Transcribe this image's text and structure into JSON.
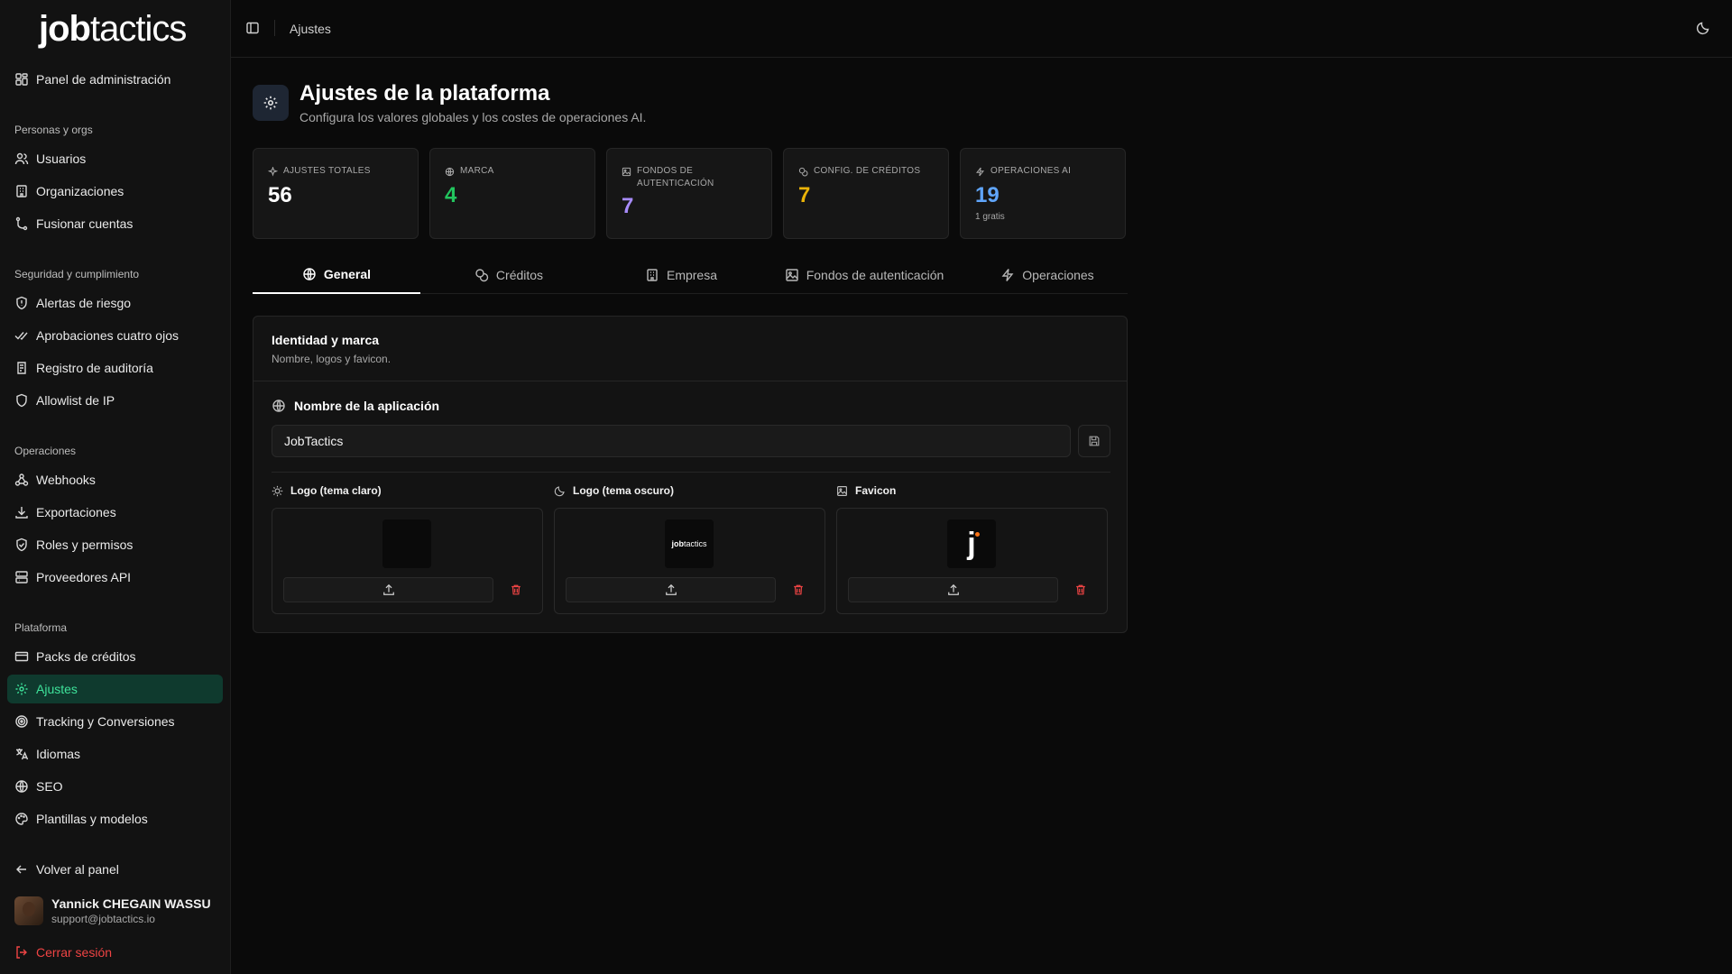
{
  "app": {
    "logo_bold": "job",
    "logo_light": "tactics"
  },
  "breadcrumb": {
    "current": "Ajustes"
  },
  "sidebar": {
    "top_item": "Panel de administración",
    "sections": [
      {
        "label": "Personas y orgs",
        "items": [
          "Usuarios",
          "Organizaciones",
          "Fusionar cuentas"
        ]
      },
      {
        "label": "Seguridad y cumplimiento",
        "items": [
          "Alertas de riesgo",
          "Aprobaciones cuatro ojos",
          "Registro de auditoría",
          "Allowlist de IP"
        ]
      },
      {
        "label": "Operaciones",
        "items": [
          "Webhooks",
          "Exportaciones",
          "Roles y permisos",
          "Proveedores API"
        ]
      },
      {
        "label": "Plataforma",
        "items": [
          "Packs de créditos",
          "Ajustes",
          "Tracking y Conversiones",
          "Idiomas",
          "SEO",
          "Plantillas y modelos"
        ]
      }
    ],
    "back": "Volver al panel",
    "user": {
      "name": "Yannick CHEGAIN WASSU",
      "email": "support@jobtactics.io"
    },
    "logout": "Cerrar sesión",
    "active_color": "#3ee29a"
  },
  "page": {
    "title": "Ajustes de la plataforma",
    "subtitle": "Configura los valores globales y los costes de operaciones AI."
  },
  "stats": [
    {
      "label": "Ajustes totales",
      "value": "56",
      "color": "#ffffff",
      "icon": "sparkles-icon"
    },
    {
      "label": "Marca",
      "value": "4",
      "color": "#22c55e",
      "icon": "globe-icon"
    },
    {
      "label": "Fondos de autenticación",
      "value": "7",
      "color": "#a78bfa",
      "icon": "image-icon"
    },
    {
      "label": "Config. de créditos",
      "value": "7",
      "color": "#eab308",
      "icon": "coins-icon"
    },
    {
      "label": "Operaciones AI",
      "value": "19",
      "color": "#60a5fa",
      "icon": "bolt-icon",
      "note": "1 gratis"
    }
  ],
  "tabs": [
    {
      "label": "General",
      "active": true
    },
    {
      "label": "Créditos"
    },
    {
      "label": "Empresa"
    },
    {
      "label": "Fondos de autenticación"
    },
    {
      "label": "Operaciones"
    }
  ],
  "card": {
    "title": "Identidad y marca",
    "subtitle": "Nombre, logos y favicon.",
    "app_name_label": "Nombre de la aplicación",
    "app_name_value": "JobTactics",
    "uploads": [
      {
        "label": "Logo (tema claro)",
        "icon": "sun-icon",
        "preview": "dark-empty"
      },
      {
        "label": "Logo (tema oscuro)",
        "icon": "moon-icon",
        "preview": "jobtactics"
      },
      {
        "label": "Favicon",
        "icon": "image-icon",
        "preview": "j"
      }
    ]
  }
}
